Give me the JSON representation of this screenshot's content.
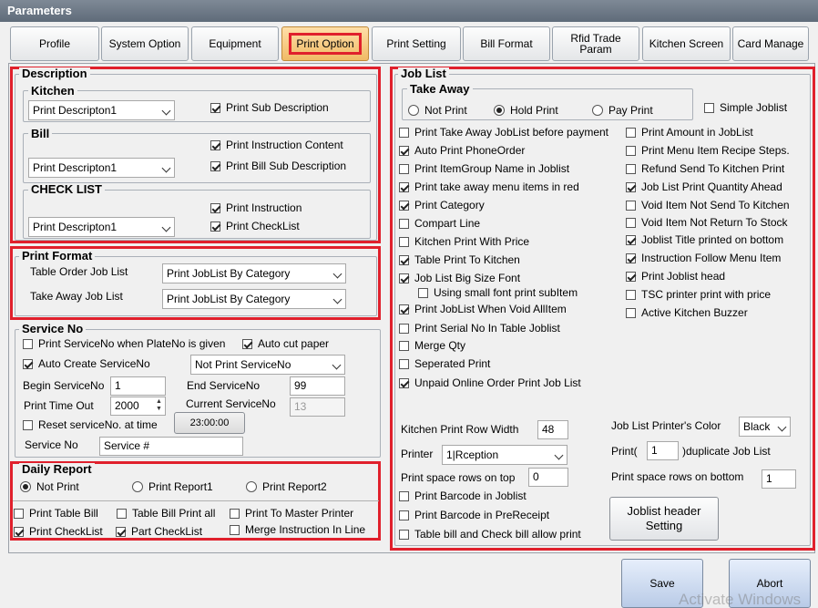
{
  "window": {
    "title": "Parameters"
  },
  "tabs": [
    {
      "label": "Profile"
    },
    {
      "label": "System Option"
    },
    {
      "label": "Equipment"
    },
    {
      "label": "Print Option"
    },
    {
      "label": "Print Setting"
    },
    {
      "label": "Bill Format"
    },
    {
      "label": "Rfid Trade Param"
    },
    {
      "label": "Kitchen Screen"
    },
    {
      "label": "Card Manage"
    }
  ],
  "description": {
    "title": "Description",
    "kitchen": {
      "title": "Kitchen",
      "select": "Print Descripton1",
      "cb_sub_description": "Print Sub Description"
    },
    "bill": {
      "title": "Bill",
      "select": "Print Descripton1",
      "cb_instruction_content": "Print Instruction Content",
      "cb_bill_sub_description": "Print Bill Sub Description"
    },
    "checklist": {
      "title": "CHECK LIST",
      "select": "Print Descripton1",
      "cb_print_instruction": "Print Instruction",
      "cb_print_checklist": "Print CheckList"
    }
  },
  "print_format": {
    "title": "Print Format",
    "table_order_label": "Table Order Job List",
    "table_order_value": "Print JobList By Category",
    "take_away_label": "Take Away Job List",
    "take_away_value": "Print JobList By Category"
  },
  "service_no": {
    "title": "Service No",
    "cb_print_when_plate": "Print ServiceNo when PlateNo is given",
    "cb_auto_cut": "Auto cut paper",
    "cb_auto_create": "Auto Create ServiceNo",
    "print_mode_value": "Not Print ServiceNo",
    "begin_label": "Begin ServiceNo",
    "begin_value": "1",
    "end_label": "End ServiceNo",
    "end_value": "99",
    "time_out_label": "Print Time Out",
    "time_out_value": "2000",
    "current_label": "Current ServiceNo",
    "current_value": "13",
    "cb_reset": "Reset serviceNo. at time",
    "reset_time": "23:00:00",
    "service_no_label": "Service No",
    "service_no_value": "Service #"
  },
  "daily_report": {
    "title": "Daily Report",
    "radio_not_print": "Not Print",
    "radio_report1": "Print Report1",
    "radio_report2": "Print Report2",
    "cb_table_bill": "Print Table Bill",
    "cb_table_bill_all": "Table Bill Print all",
    "cb_master_printer": "Print To Master Printer",
    "cb_checklist": "Print CheckList",
    "cb_part_checklist": "Part CheckList",
    "cb_merge_instruction": "Merge Instruction In Line"
  },
  "job_list": {
    "title": "Job List",
    "take_away": {
      "title": "Take Away",
      "radio_not_print": "Not Print",
      "radio_hold_print": "Hold Print",
      "radio_pay_print": "Pay Print"
    },
    "cb_simple_joblist": "Simple Joblist",
    "left_options": [
      {
        "label": "Print Take Away JobList before payment",
        "checked": false
      },
      {
        "label": "Auto Print PhoneOrder",
        "checked": true
      },
      {
        "label": "Print ItemGroup Name in Joblist",
        "checked": false
      },
      {
        "label": "Print take away menu items in red",
        "checked": true
      },
      {
        "label": "Print Category",
        "checked": true
      },
      {
        "label": "Compart Line",
        "checked": false
      },
      {
        "label": "Kitchen Print With Price",
        "checked": false
      },
      {
        "label": "Table Print To Kitchen",
        "checked": true
      },
      {
        "label": "Job List Big Size Font",
        "checked": true
      },
      {
        "label": "Using small font print subItem",
        "checked": false
      },
      {
        "label": "Print JobList When Void AllItem",
        "checked": true
      },
      {
        "label": "Print Serial No In Table Joblist",
        "checked": false
      },
      {
        "label": "Merge Qty",
        "checked": false
      },
      {
        "label": "Seperated Print",
        "checked": false
      },
      {
        "label": "Unpaid Online Order Print Job List",
        "checked": true
      }
    ],
    "right_options": [
      {
        "label": "Print Amount in JobList",
        "checked": false
      },
      {
        "label": "Print Menu Item Recipe Steps.",
        "checked": false
      },
      {
        "label": "Refund Send To Kitchen Print",
        "checked": false
      },
      {
        "label": "Job List Print Quantity Ahead",
        "checked": true
      },
      {
        "label": "Void Item Not Send To Kitchen",
        "checked": false
      },
      {
        "label": "Void Item Not Return To Stock",
        "checked": false
      },
      {
        "label": "Joblist Title printed on bottom",
        "checked": true
      },
      {
        "label": "Instruction Follow Menu Item",
        "checked": true
      },
      {
        "label": "Print Joblist head",
        "checked": true
      },
      {
        "label": "TSC printer print with price",
        "checked": false
      },
      {
        "label": "Active Kitchen Buzzer",
        "checked": false
      }
    ],
    "row_width_label": "Kitchen Print Row Width",
    "row_width_value": "48",
    "printer_color_label": "Job List Printer's Color",
    "printer_color_value": "Black",
    "printer_label": "Printer",
    "printer_value": "1|Rception",
    "duplicate_prefix": "Print(",
    "duplicate_value": "1",
    "duplicate_suffix": ")duplicate Job List",
    "space_top_label": "Print space rows on top",
    "space_top_value": "0",
    "space_bottom_label": "Print space rows on bottom",
    "space_bottom_value": "1",
    "cb_barcode_joblist": "Print Barcode in Joblist",
    "cb_barcode_prereceipt": "Print Barcode in PreReceipt",
    "cb_table_bill_check": "Table bill and Check bill allow print",
    "header_setting_button": "Joblist header Setting"
  },
  "footer": {
    "save": "Save",
    "abort": "Abort",
    "watermark": "Activate Windows"
  }
}
